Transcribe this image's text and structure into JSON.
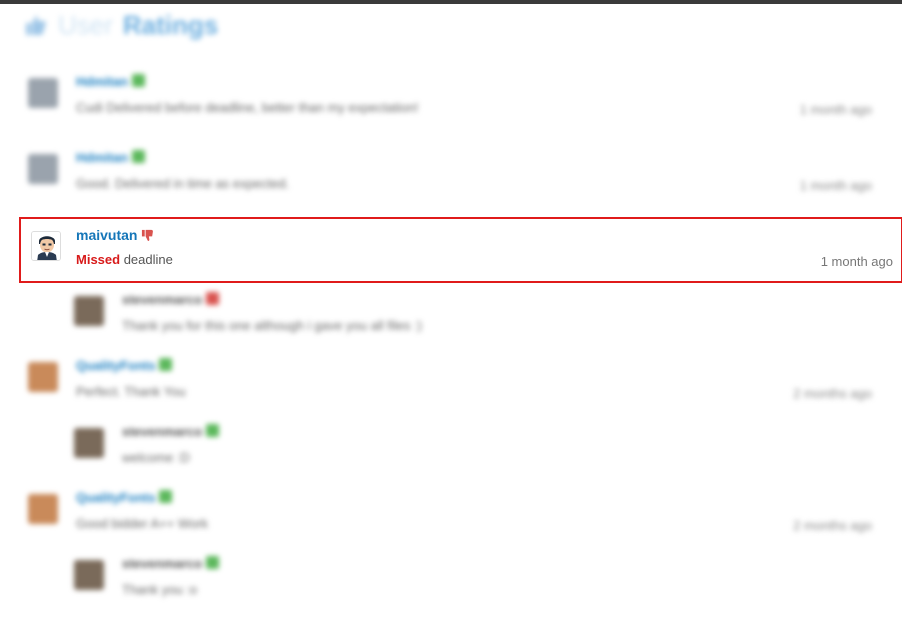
{
  "header": {
    "title_part1": "User",
    "title_part2": "Ratings",
    "icon": "thumbs-up-icon"
  },
  "reviews": [
    {
      "user": "Hdmitan",
      "rating": "positive",
      "comment": "Cudi Delivered before deadline, better than my expectation!",
      "time": "1 month ago",
      "reply": false
    },
    {
      "user": "Hdmitan",
      "rating": "positive",
      "comment": "Good. Delivered in time as expected.",
      "time": "1 month ago",
      "reply": false
    },
    {
      "user": "stevenmarco",
      "rating": "negative",
      "comment": "Thank you for this one although i gave you all files :)",
      "time": "",
      "reply": true
    },
    {
      "user": "QualityFonts",
      "rating": "positive",
      "comment": "Perfect. Thank You",
      "time": "2 months ago",
      "reply": false
    },
    {
      "user": "stevenmarco",
      "rating": "positive",
      "comment": "welcome :D",
      "time": "",
      "reply": true
    },
    {
      "user": "QualityFonts",
      "rating": "positive",
      "comment": "Good bidder A++ Work",
      "time": "2 months ago",
      "reply": false
    },
    {
      "user": "stevenmarco",
      "rating": "positive",
      "comment": "Thank you :o",
      "time": "",
      "reply": true
    }
  ],
  "highlighted_review": {
    "user": "maivutan",
    "rating": "negative",
    "comment_emphasis": "Missed",
    "comment_rest": "deadline",
    "time": "1 month ago"
  },
  "colors": {
    "highlight_border": "#e01b1b",
    "username": "#1576b8",
    "missed": "#d81b1b",
    "positive": "#5cb85c",
    "negative": "#d9534f"
  }
}
